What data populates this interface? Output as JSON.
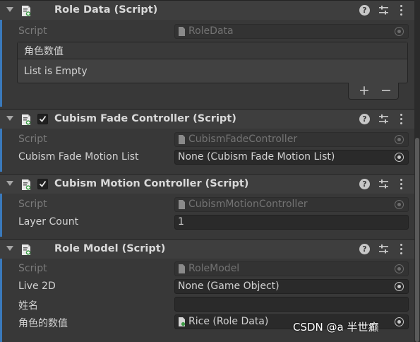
{
  "components": [
    {
      "title": "Role Data (Script)",
      "has_checkbox": false,
      "script_label": "Script",
      "script_value": "RoleData",
      "list": {
        "header": "角色数值",
        "empty_text": "List is Empty",
        "add_label": "+",
        "remove_label": "−"
      }
    },
    {
      "title": "Cubism Fade Controller (Script)",
      "has_checkbox": true,
      "checked": true,
      "script_label": "Script",
      "script_value": "CubismFadeController",
      "fields": [
        {
          "label": "Cubism Fade Motion List",
          "value": "None (Cubism Fade Motion List)",
          "has_picker": true
        }
      ]
    },
    {
      "title": "Cubism Motion Controller (Script)",
      "has_checkbox": true,
      "checked": true,
      "script_label": "Script",
      "script_value": "CubismMotionController",
      "fields": [
        {
          "label": "Layer Count",
          "value": "1",
          "has_picker": false
        }
      ]
    },
    {
      "title": "Role Model (Script)",
      "has_checkbox": false,
      "script_label": "Script",
      "script_value": "RoleModel",
      "fields": [
        {
          "label": "Live 2D",
          "value": "None (Game Object)",
          "has_picker": true
        },
        {
          "label": "姓名",
          "value": "",
          "has_picker": false
        },
        {
          "label": "角色的数值",
          "value": "Rice (Role Data)",
          "has_picker": true,
          "has_icon": true
        }
      ]
    }
  ],
  "header_buttons": {
    "help_label": "?"
  },
  "watermark": "CSDN @a 半世癫",
  "colors": {
    "accent": "#3a79bb",
    "background": "#383838",
    "header": "#3e3e3e",
    "field": "#2a2a2a"
  },
  "icons": [
    "foldout-arrow-icon",
    "script-icon",
    "checkmark-icon",
    "help-icon",
    "preset-icon",
    "kebab-menu-icon",
    "object-picker-icon",
    "script-asset-icon"
  ]
}
